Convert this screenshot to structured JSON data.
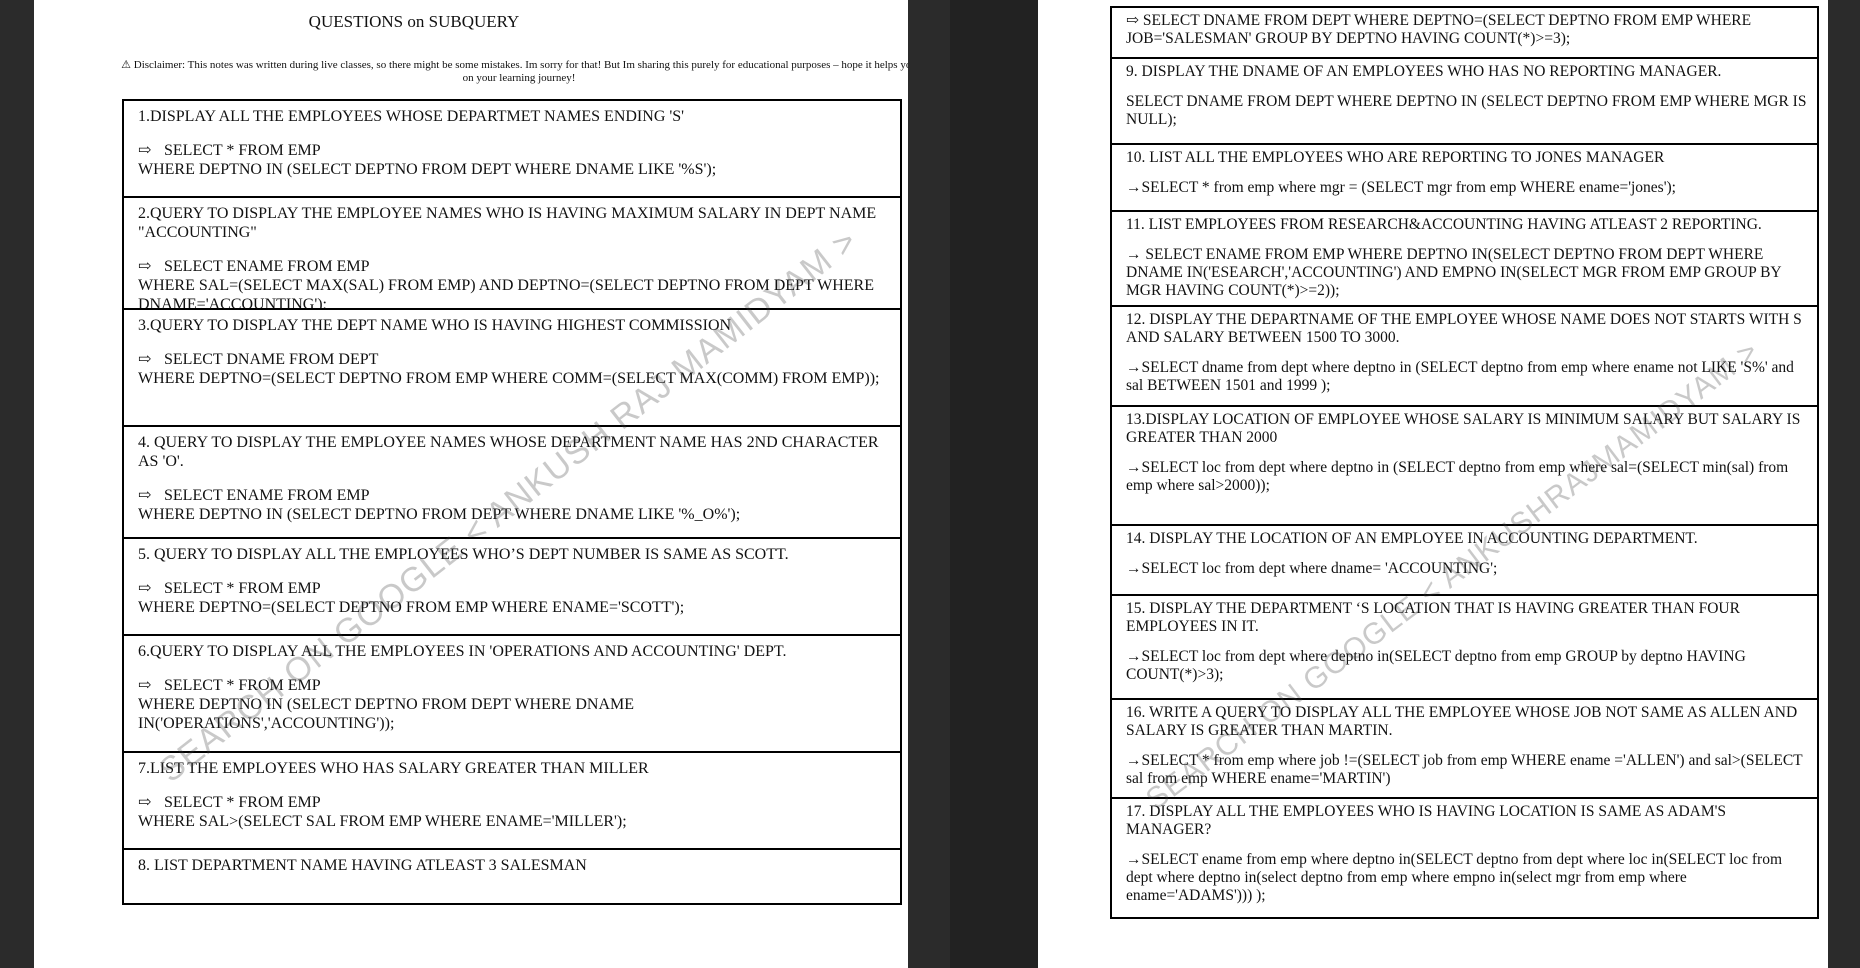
{
  "title": "QUESTIONS on SUBQUERY",
  "disclaimer": "⚠ Disclaimer: This notes was written during live classes, so there might be some mistakes. Im sorry for that! But Im sharing this purely for educational purposes – hope it helps you on your learning journey!",
  "watermark": "SEARCH ON GOOGLE < ANKUSH RAJ MAMIDYAM >",
  "watermark_right": "SEARCH ON GOOGLE < ANKUSHRAJMAMIDYAM >",
  "left_items": [
    {
      "q": "1.DISPLAY ALL THE EMPLOYEES WHOSE DEPARTMET NAMES ENDING 'S'",
      "a": "SELECT * FROM EMP",
      "a2": "WHERE DEPTNO IN (SELECT DEPTNO FROM DEPT WHERE DNAME LIKE '%S');"
    },
    {
      "q": "2.QUERY TO DISPLAY THE EMPLOYEE NAMES WHO IS HAVING MAXIMUM SALARY IN DEPT NAME \"ACCOUNTING\"",
      "a": "SELECT ENAME FROM  EMP",
      "a2": "WHERE SAL=(SELECT MAX(SAL) FROM EMP) AND DEPTNO=(SELECT DEPTNO FROM DEPT WHERE DNAME='ACCOUNTING');"
    },
    {
      "q": "3.QUERY TO DISPLAY THE DEPT NAME WHO IS HAVING HIGHEST COMMISSION",
      "a": "SELECT DNAME FROM DEPT",
      "a2": "WHERE DEPTNO=(SELECT DEPTNO FROM EMP WHERE COMM=(SELECT MAX(COMM) FROM EMP));"
    },
    {
      "q": "4. QUERY TO DISPLAY THE EMPLOYEE NAMES WHOSE DEPARTMENT NAME HAS 2ND CHARACTER AS 'O'.",
      "a": "SELECT ENAME FROM  EMP",
      "a2": "WHERE DEPTNO IN (SELECT DEPTNO FROM DEPT WHERE DNAME LIKE '%_O%');"
    },
    {
      "q": "5. QUERY TO DISPLAY ALL THE EMPLOYEES WHO’S DEPT NUMBER IS SAME AS SCOTT.",
      "a": "SELECT * FROM EMP",
      "a2": "WHERE DEPTNO=(SELECT DEPTNO FROM EMP WHERE ENAME='SCOTT');"
    },
    {
      "q": "6.QUERY TO DISPLAY ALL THE EMPLOYEES IN 'OPERATIONS AND ACCOUNTING' DEPT.",
      "a": "SELECT * FROM EMP",
      "a2": "WHERE DEPTNO IN (SELECT DEPTNO FROM DEPT WHERE DNAME IN('OPERATIONS','ACCOUNTING'));"
    },
    {
      "q": "7.LIST THE EMPLOYEES WHO HAS SALARY GREATER THAN MILLER",
      "a": "SELECT * FROM EMP",
      "a2": "WHERE SAL>(SELECT SAL FROM EMP WHERE ENAME='MILLER');"
    },
    {
      "q": "8. LIST DEPARTMENT NAME HAVING ATLEAST 3 SALESMAN",
      "a": "",
      "a2": ""
    }
  ],
  "right_items": [
    {
      "q": "",
      "a": "⇨ SELECT DNAME  FROM DEPT  WHERE DEPTNO=(SELECT DEPTNO FROM EMP WHERE JOB='SALESMAN'  GROUP BY DEPTNO  HAVING COUNT(*)>=3);"
    },
    {
      "q": "9. DISPLAY THE DNAME OF AN EMPLOYEES WHO HAS NO REPORTING MANAGER.",
      "a": "SELECT DNAME FROM DEPT WHERE DEPTNO IN (SELECT DEPTNO FROM EMP WHERE MGR IS NULL);"
    },
    {
      "q": "10. LIST ALL THE EMPLOYEES WHO ARE REPORTING TO JONES MANAGER",
      "a": "→SELECT * from emp where mgr = (SELECT mgr from emp WHERE ename='jones');"
    },
    {
      "q": "11. LIST EMPLOYEES FROM RESEARCH&ACCOUNTING HAVING ATLEAST 2 REPORTING.",
      "a": "→ SELECT ENAME FROM EMP WHERE DEPTNO IN(SELECT DEPTNO FROM DEPT WHERE DNAME IN('ESEARCH','ACCOUNTING') AND EMPNO IN(SELECT MGR FROM EMP GROUP BY MGR HAVING COUNT(*)>=2));"
    },
    {
      "q": "12. DISPLAY THE DEPARTNAME OF THE EMPLOYEE WHOSE NAME DOES NOT STARTS WITH S AND SALARY BETWEEN 1500 TO 3000.",
      "a": "→SELECT dname from dept where deptno in (SELECT deptno from emp where ename not LIKE 'S%' and sal BETWEEN 1501 and 1999 );"
    },
    {
      "q": "13.DISPLAY LOCATION OF EMPLOYEE WHOSE SALARY IS MINIMUM SALARY BUT SALARY IS GREATER THAN 2000",
      "a": "→SELECT loc from dept where deptno in (SELECT deptno from emp where sal=(SELECT min(sal) from emp where sal>2000));"
    },
    {
      "q": "14. DISPLAY THE LOCATION OF AN EMPLOYEE IN ACCOUNTING DEPARTMENT.",
      "a": "→SELECT loc from dept where dname= 'ACCOUNTING';"
    },
    {
      "q": "15. DISPLAY THE DEPARTMENT ‘S LOCATION THAT IS HAVING GREATER THAN FOUR EMPLOYEES IN IT.",
      "a": "→SELECT loc from dept where deptno in(SELECT deptno from emp GROUP by deptno HAVING COUNT(*)>3);"
    },
    {
      "q": "16. WRITE A QUERY TO DISPLAY ALL THE EMPLOYEE WHOSE JOB NOT SAME AS ALLEN AND SALARY IS GREATER THAN MARTIN.",
      "a": "→SELECT * from emp where job !=(SELECT job from emp WHERE ename ='ALLEN') and sal>(SELECT sal from emp WHERE ename='MARTIN')"
    },
    {
      "q": "17. DISPLAY ALL THE EMPLOYEES WHO IS HAVING LOCATION IS SAME AS ADAM'S MANAGER?",
      "a": "→SELECT ename from emp where deptno in(SELECT deptno from dept where loc in(SELECT loc from dept where deptno in(select deptno from emp where empno in(select mgr from emp where ename='ADAMS'))) );"
    }
  ]
}
